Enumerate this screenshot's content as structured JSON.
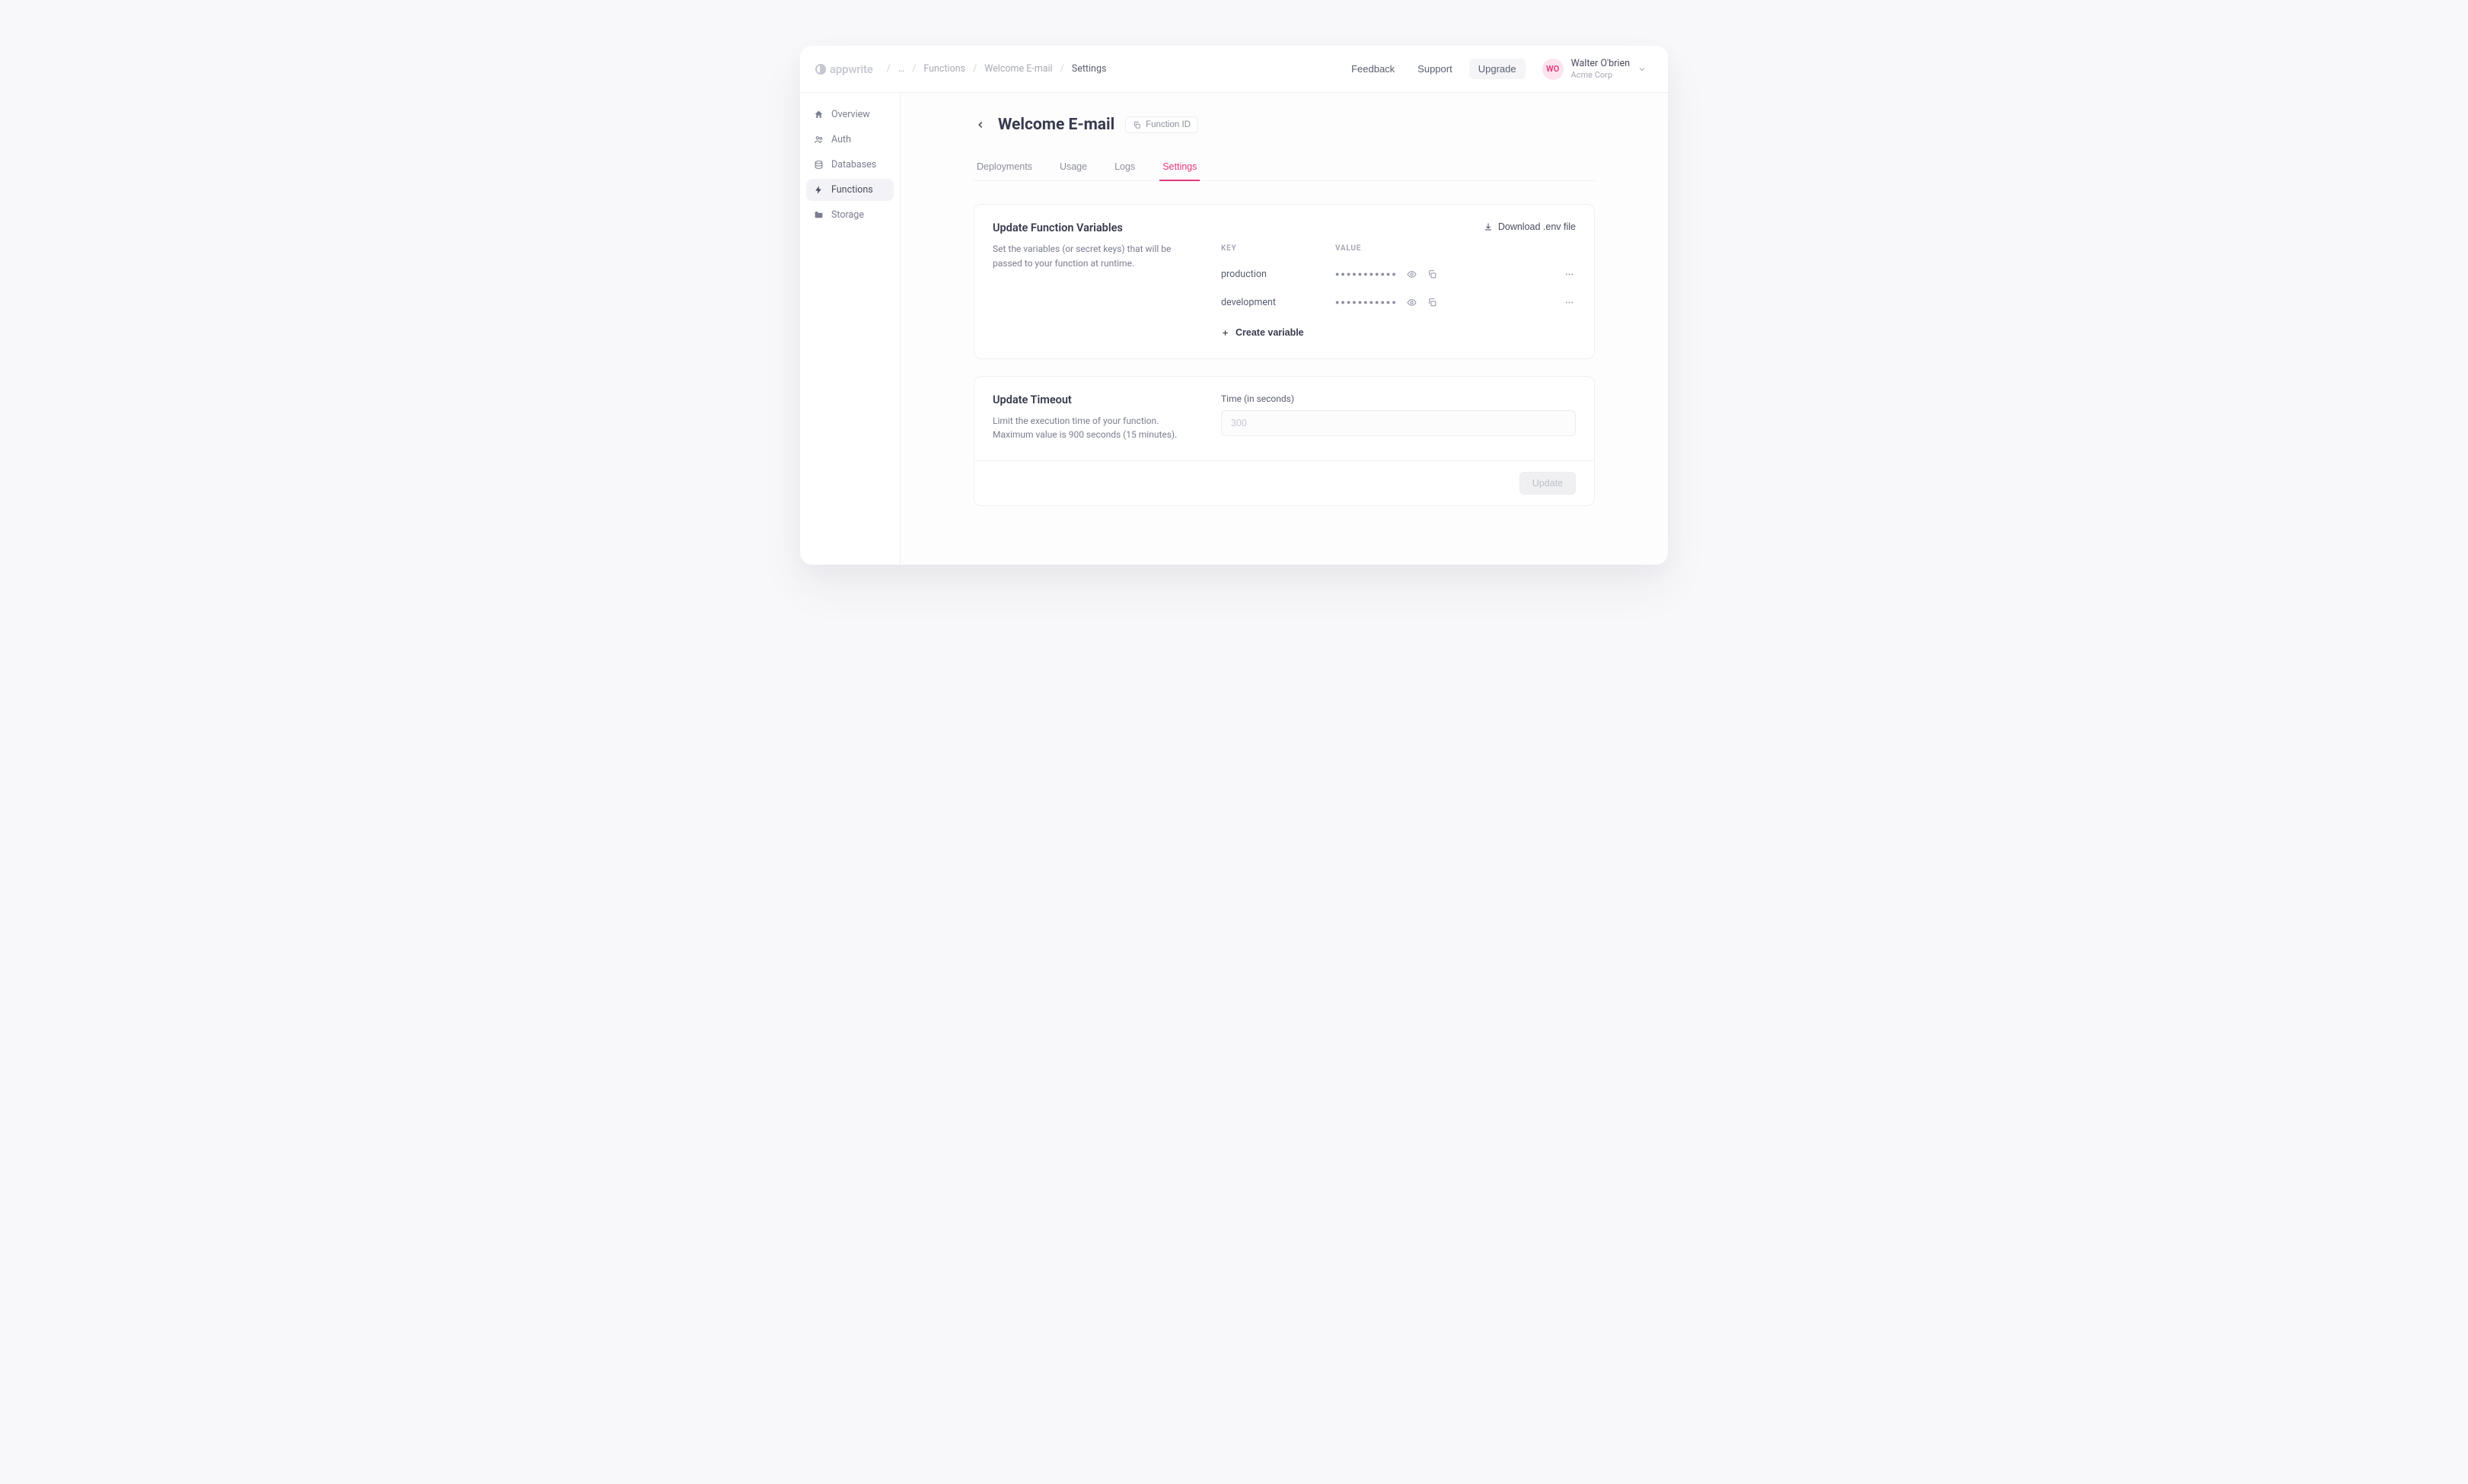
{
  "brand": "appwrite",
  "breadcrumbs": {
    "ellipsis": "…",
    "items": [
      "Functions",
      "Welcome E-mail"
    ],
    "current": "Settings"
  },
  "header": {
    "feedback": "Feedback",
    "support": "Support",
    "upgrade": "Upgrade"
  },
  "user": {
    "initials": "WO",
    "name": "Walter O'brien",
    "org": "Acme Corp"
  },
  "sidebar": [
    {
      "icon": "home",
      "label": "Overview",
      "active": false
    },
    {
      "icon": "users",
      "label": "Auth",
      "active": false
    },
    {
      "icon": "database",
      "label": "Databases",
      "active": false
    },
    {
      "icon": "bolt",
      "label": "Functions",
      "active": true
    },
    {
      "icon": "folder",
      "label": "Storage",
      "active": false
    }
  ],
  "page": {
    "title": "Welcome E-mail",
    "fnid_label": "Function ID"
  },
  "tabs": [
    {
      "label": "Deployments",
      "active": false
    },
    {
      "label": "Usage",
      "active": false
    },
    {
      "label": "Logs",
      "active": false
    },
    {
      "label": "Settings",
      "active": true
    }
  ],
  "variables_card": {
    "title": "Update Function Variables",
    "desc": "Set the variables (or secret keys) that will be passed to your function at runtime.",
    "download": "Download .env file",
    "head_key": "KEY",
    "head_value": "VALUE",
    "masked": "●●●●●●●●●●●",
    "rows": [
      {
        "key": "production"
      },
      {
        "key": "development"
      }
    ],
    "create": "Create variable"
  },
  "timeout_card": {
    "title": "Update Timeout",
    "desc": "Limit the execution time of your function. Maximum value is 900 seconds (15 minutes).",
    "label": "Time (in seconds)",
    "placeholder": "300",
    "update": "Update"
  }
}
